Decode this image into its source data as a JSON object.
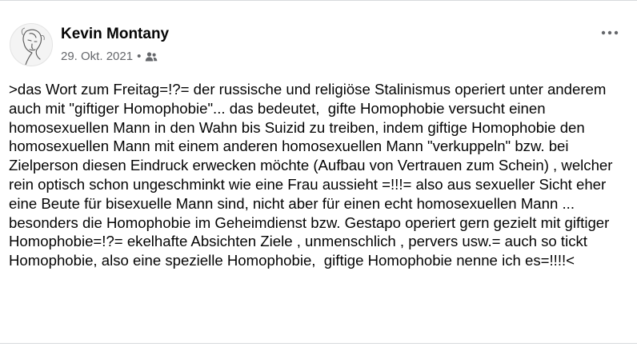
{
  "post": {
    "author": "Kevin Montany",
    "date": "29. Okt. 2021",
    "separator": "•",
    "audience_icon": "friends-icon",
    "more_icon": "more-options-icon",
    "body": ">das Wort zum Freitag=!?= der russische und religiöse Stalinismus operiert unter anderem auch mit \"giftiger Homophobie\"... das bedeutet,  gifte Homophobie versucht einen homosexuellen Mann in den Wahn bis Suizid zu treiben, indem giftige Homophobie den homosexuellen Mann mit einem anderen homosexuellen Mann \"verkuppeln\" bzw. bei Zielperson diesen Eindruck erwecken möchte (Aufbau von Vertrauen zum Schein) , welcher rein optisch schon ungeschminkt wie eine Frau aussieht =!!!= also aus sexueller Sicht eher eine Beute für bisexuelle Mann sind, nicht aber für einen echt homosexuellen Mann ... besonders die Homophobie im Geheimdienst bzw. Gestapo operiert gern gezielt mit giftiger Homophobie=!?= ekelhafte Absichten Ziele , unmenschlich , pervers usw.= auch so tickt Homophobie, also eine spezielle Homophobie,  giftige Homophobie nenne ich es=!!!!<"
  },
  "colors": {
    "text": "#050505",
    "secondary": "#65676b",
    "divider": "#d7d9dc"
  }
}
